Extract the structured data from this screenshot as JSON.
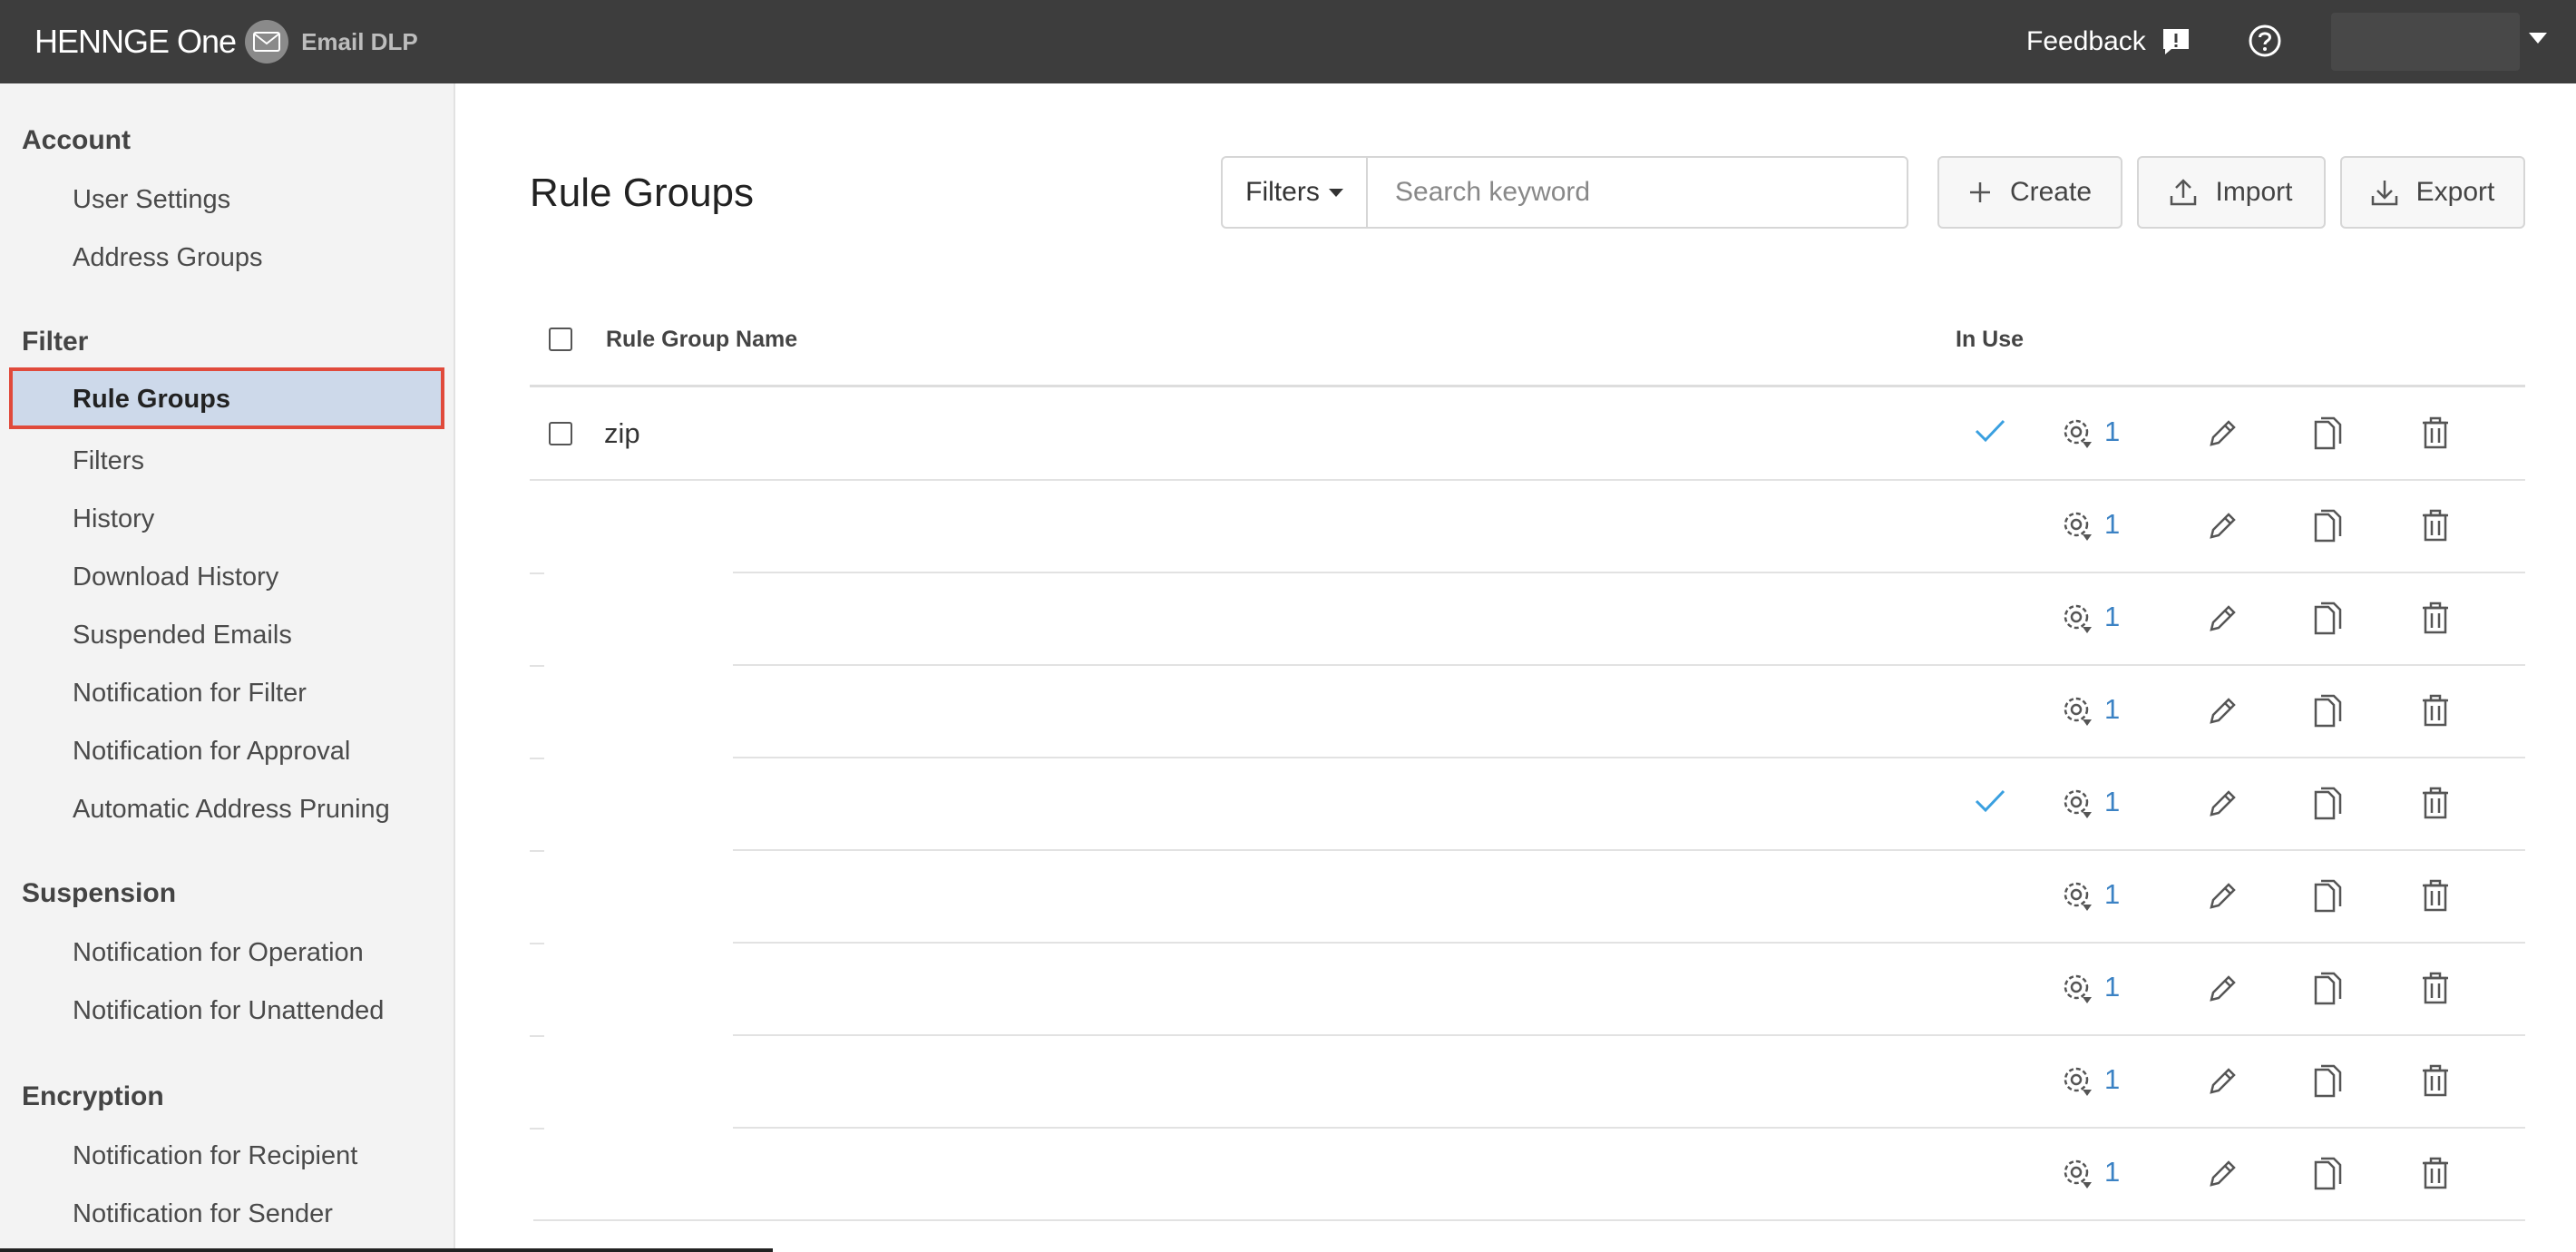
{
  "header": {
    "logo_text": "HENNGE One",
    "product_name": "Email DLP",
    "feedback_label": "Feedback"
  },
  "sidebar": {
    "sections": [
      {
        "title": "Account",
        "items": [
          "User Settings",
          "Address Groups"
        ]
      },
      {
        "title": "Filter",
        "items": [
          "Rule Groups",
          "Filters",
          "History",
          "Download History",
          "Suspended Emails",
          "Notification for Filter",
          "Notification for Approval",
          "Automatic Address Pruning"
        ]
      },
      {
        "title": "Suspension",
        "items": [
          "Notification for Operation",
          "Notification for Unattended"
        ]
      },
      {
        "title": "Encryption",
        "items": [
          "Notification for Recipient",
          "Notification for Sender"
        ]
      }
    ],
    "active_item": "Rule Groups"
  },
  "main": {
    "title": "Rule Groups",
    "filters_label": "Filters",
    "search_placeholder": "Search keyword",
    "buttons": {
      "create": "Create",
      "import": "Import",
      "export": "Export"
    }
  },
  "table": {
    "columns": {
      "name": "Rule Group Name",
      "in_use": "In Use"
    },
    "rows": [
      {
        "name": "zip",
        "in_use": true,
        "count": "1"
      },
      {
        "name": "",
        "in_use": false,
        "count": "1"
      },
      {
        "name": "",
        "in_use": false,
        "count": "1"
      },
      {
        "name": "",
        "in_use": false,
        "count": "1"
      },
      {
        "name": "",
        "in_use": true,
        "count": "1"
      },
      {
        "name": "",
        "in_use": false,
        "count": "1"
      },
      {
        "name": "",
        "in_use": false,
        "count": "1"
      },
      {
        "name": "",
        "in_use": false,
        "count": "1"
      },
      {
        "name": "",
        "in_use": false,
        "count": "1"
      }
    ]
  },
  "colors": {
    "topbar": "#3d3d3d",
    "sidebar_bg": "#f3f3f3",
    "active_bg": "#cdd9ea",
    "highlight_border": "#e04a3b",
    "link": "#3b82c4",
    "check": "#3aa0e0"
  }
}
